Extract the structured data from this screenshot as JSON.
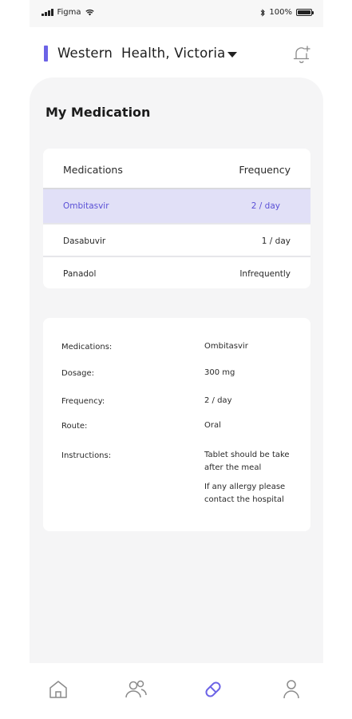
{
  "status_bar": {
    "carrier": "Figma",
    "battery": "100%"
  },
  "header": {
    "organization": "Western  Health, Victoria"
  },
  "page": {
    "title": "My Medication"
  },
  "medication_table": {
    "headers": [
      "Medications",
      "Frequency"
    ],
    "rows": [
      {
        "name": "Ombitasvir",
        "frequency": "2 / day",
        "selected": true
      },
      {
        "name": "Dasabuvir",
        "frequency": "1 / day",
        "selected": false
      },
      {
        "name": "Panadol",
        "frequency": "Infrequently",
        "selected": false
      }
    ]
  },
  "details": {
    "medication_label": "Medications:",
    "medication_value": "Ombitasvir",
    "dosage_label": "Dosage:",
    "dosage_value": "300 mg",
    "frequency_label": "Frequency:",
    "frequency_value": "2 / day",
    "route_label": "Route:",
    "route_value": "Oral",
    "instructions_label": "Instructions:",
    "instructions_line1": "Tablet should be take after the meal",
    "instructions_line2": "If any allergy please contact the hospital"
  },
  "bottom_nav": {
    "items": [
      {
        "icon": "home-icon",
        "active": false
      },
      {
        "icon": "people-icon",
        "active": false
      },
      {
        "icon": "pill-icon",
        "active": true
      },
      {
        "icon": "profile-icon",
        "active": false
      }
    ]
  },
  "colors": {
    "accent": "#6c63e6",
    "selected_row_bg": "#e1e0f7",
    "selected_row_text": "#5a50d6",
    "content_bg": "#f5f5f6"
  }
}
